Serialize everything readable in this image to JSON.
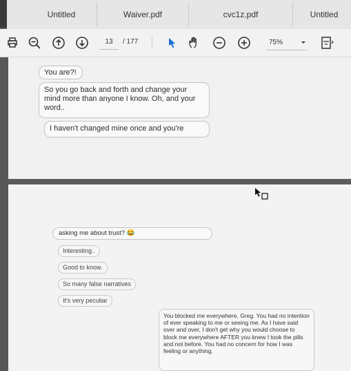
{
  "tabs": [
    "Untitled",
    "Waiver.pdf",
    "cvc1z.pdf",
    "Untitled"
  ],
  "toolbar": {
    "page_current": "13",
    "page_total": "/ 177",
    "zoom": "75%"
  },
  "messages_page1": [
    "You are?!",
    "So you go back and forth and change your mind more than anyone I know. Oh, and your word..",
    "I haven't changed mine once and you're"
  ],
  "messages_page2": {
    "first": "asking me about trust? 😂",
    "short_replies": [
      "Interesting..",
      "Good to know.",
      "So many false narratives",
      "It's very peculiar"
    ],
    "long_reply": "You blocked me everywhere, Greg. You had no intention of ever speaking to me or seeing me. As I have said over and over, I don't get why you would choose to block me everywhere AFTER you knew I took the pills and not before. You had no concern for how I was feeling or anything."
  },
  "icons": {
    "print": "printer-icon",
    "zoom_out": "zoom-out-icon",
    "up": "arrow-up-icon",
    "down": "arrow-down-icon",
    "select": "cursor-arrow-icon",
    "hand": "hand-icon",
    "minus": "minus-circle-icon",
    "plus": "plus-circle-icon",
    "fit": "fit-page-icon"
  },
  "colors": {
    "toolbar_bg": "#f2f2f2",
    "tab_bg": "#e6e6e6",
    "accent": "#1e6fd6"
  }
}
